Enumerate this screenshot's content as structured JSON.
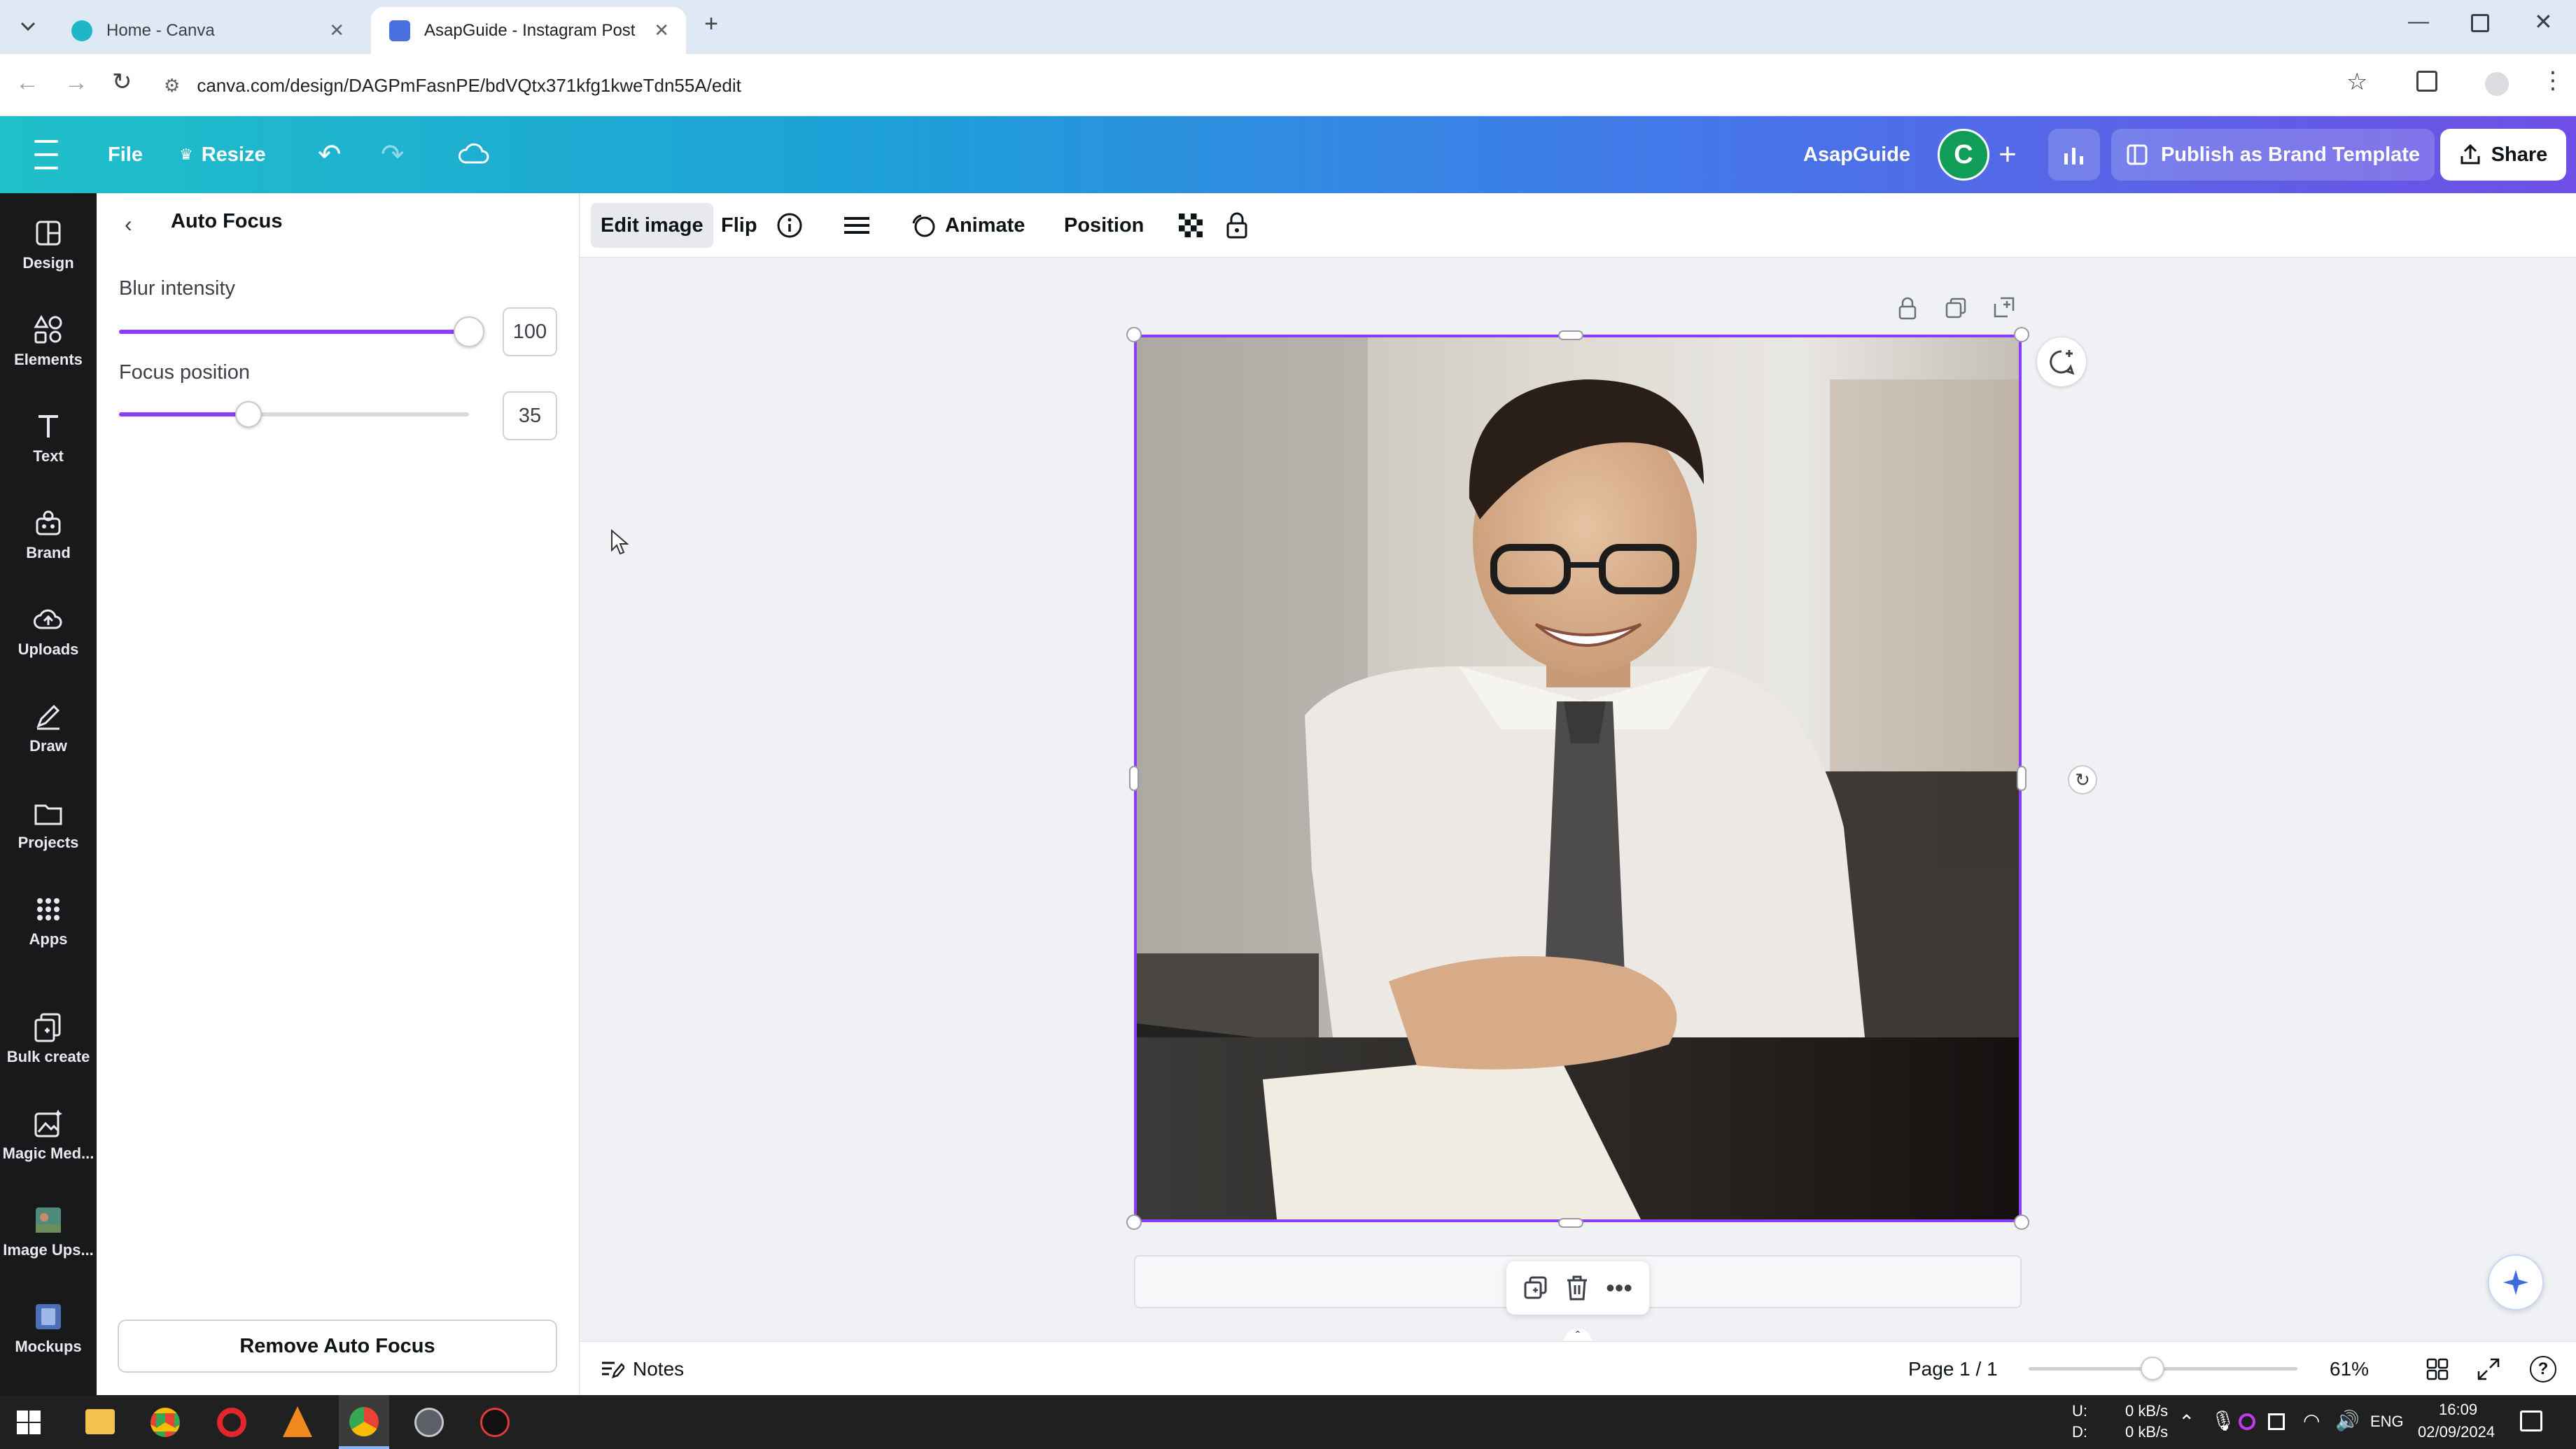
{
  "browser": {
    "tabs": [
      {
        "title": "Home - Canva",
        "active": false
      },
      {
        "title": "AsapGuide - Instagram Post",
        "active": true
      }
    ],
    "url": "canva.com/design/DAGPmFasnPE/bdVQtx371kfg1kweTdn55A/edit"
  },
  "topbar": {
    "file_label": "File",
    "resize_label": "Resize",
    "brand_name": "AsapGuide",
    "avatar_letter": "C",
    "publish_label": "Publish as Brand Template",
    "share_label": "Share"
  },
  "rail": {
    "items": [
      {
        "label": "Design",
        "icon": "design-icon"
      },
      {
        "label": "Elements",
        "icon": "elements-icon"
      },
      {
        "label": "Text",
        "icon": "text-icon"
      },
      {
        "label": "Brand",
        "icon": "brand-icon"
      },
      {
        "label": "Uploads",
        "icon": "uploads-icon"
      },
      {
        "label": "Draw",
        "icon": "draw-icon"
      },
      {
        "label": "Projects",
        "icon": "projects-icon"
      },
      {
        "label": "Apps",
        "icon": "apps-icon"
      },
      {
        "label": "Bulk create",
        "icon": "bulk-create-icon"
      },
      {
        "label": "Magic Med...",
        "icon": "magic-media-icon"
      },
      {
        "label": "Image Ups...",
        "icon": "image-upscaler-icon"
      },
      {
        "label": "Mockups",
        "icon": "mockups-icon"
      }
    ]
  },
  "panel": {
    "title": "Auto Focus",
    "blur": {
      "label": "Blur intensity",
      "value": "100",
      "fraction": 1.0
    },
    "focus": {
      "label": "Focus position",
      "value": "35",
      "fraction": 0.35
    },
    "remove_label": "Remove Auto Focus"
  },
  "toolbar": {
    "edit_image": "Edit image",
    "flip": "Flip",
    "animate": "Animate",
    "position": "Position"
  },
  "footer": {
    "notes_label": "Notes",
    "page_label": "Page 1 / 1",
    "zoom_label": "61%",
    "zoom_fraction": 0.46
  },
  "taskbar": {
    "net_up": "0 kB/s",
    "net_down": "0 kB/s",
    "net_u_label": "U:",
    "net_d_label": "D:",
    "lang": "ENG",
    "time": "16:09",
    "date": "02/09/2024"
  },
  "colors": {
    "accent": "#8b3dff",
    "header_start": "#1fc0c9",
    "header_end": "#6f4fe6",
    "rail_bg": "#18191b"
  }
}
